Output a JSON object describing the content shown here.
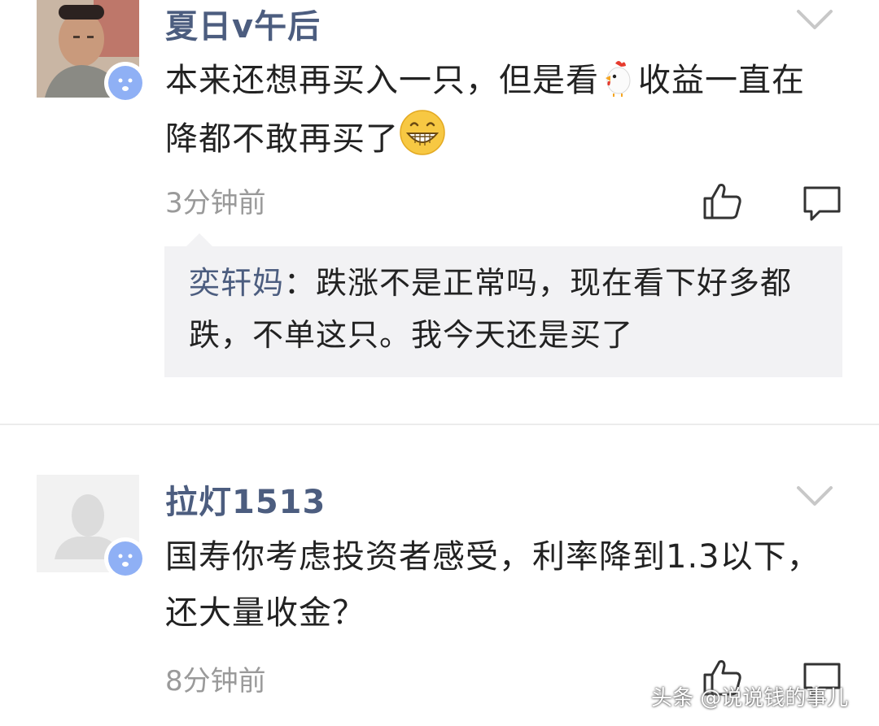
{
  "comments": [
    {
      "username": "夏日v午后",
      "text_parts": [
        "本来还想再买入一只，但是看",
        "收益一直在降都不敢再买了"
      ],
      "emojis": [
        "chicken-emoji",
        "grinning-emoji"
      ],
      "time": "3分钟前",
      "reply": {
        "name": "奕轩妈",
        "separator": "：",
        "text": "跌涨不是正常吗，现在看下好多都跌，不单这只。我今天还是买了"
      }
    },
    {
      "username": "拉灯1513",
      "text": "国寿你考虑投资者感受，利率降到1.3以下，还大量收金？",
      "time": "8分钟前"
    }
  ],
  "watermark": "头条 @说说钱的事儿",
  "icons": {
    "more": "chevron-down-icon",
    "like": "thumbs-up-icon",
    "reply": "comment-bubble-icon"
  },
  "colors": {
    "username": "#4c5d7f",
    "body": "#222222",
    "time": "#9a9a9a",
    "reply_bg": "#f2f2f4",
    "badge": "#8fb0f5"
  }
}
